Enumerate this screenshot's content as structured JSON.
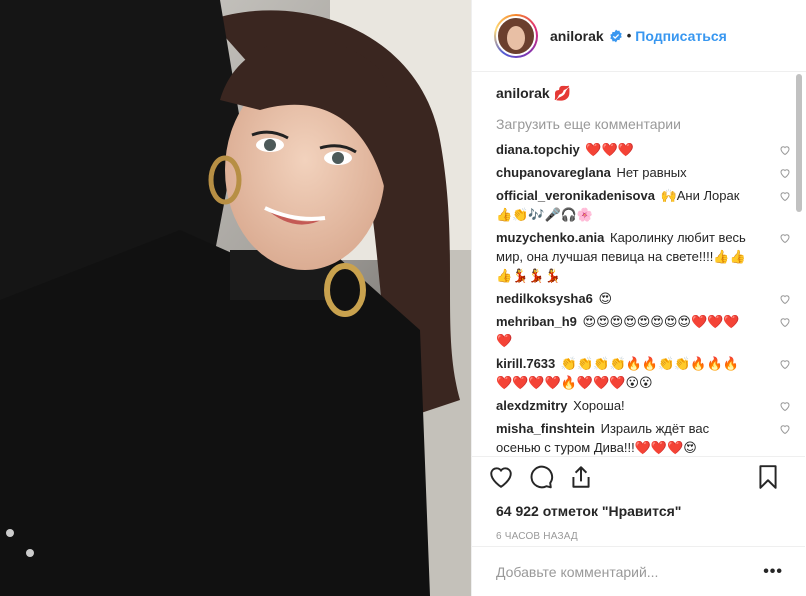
{
  "post": {
    "author": "anilorak",
    "follow_label": "Подписаться",
    "separator": "•",
    "caption_emoji": "💋",
    "load_more_label": "Загрузить еще комментарии",
    "comments": [
      {
        "user": "diana.topchiy",
        "text": "❤️❤️❤️"
      },
      {
        "user": "chupanovareglana",
        "text": "Нет равных"
      },
      {
        "user": "official_veronikadenisova",
        "text": "🙌Ани Лорак 👍👏🎶🎤🎧🌸"
      },
      {
        "user": "muzychenko.ania",
        "text": "Каролинку любит весь мир, она лучшая певица на свете!!!!👍👍👍💃💃💃"
      },
      {
        "user": "nedilkoksysha6",
        "text": "😍"
      },
      {
        "user": "mehriban_h9",
        "text": "😍😍😍😍😍😍😍😍❤️❤️❤️❤️"
      },
      {
        "user": "kirill.7633",
        "text": "👏👏👏👏🔥🔥👏👏🔥🔥🔥❤️❤️❤️❤️🔥❤️❤️❤️😮😮"
      },
      {
        "user": "alexdzmitry",
        "text": "Хороша!"
      },
      {
        "user": "misha_finshtein",
        "text": "Израиль ждёт вас осенью с туром Дива!!!❤️❤️❤️😍"
      }
    ],
    "likes": "64 922 отметок \"Нравится\"",
    "time_ago": "6 ЧАСОВ НАЗАД",
    "add_comment_placeholder": "Добавьте комментарий...",
    "more_label": "•••"
  },
  "icons": {
    "verified": "verified-badge-icon",
    "like": "heart-icon",
    "comment": "comment-bubble-icon",
    "share": "share-icon",
    "save": "bookmark-icon"
  },
  "colors": {
    "accent": "#3897f0",
    "muted": "#999999",
    "text": "#262626"
  }
}
